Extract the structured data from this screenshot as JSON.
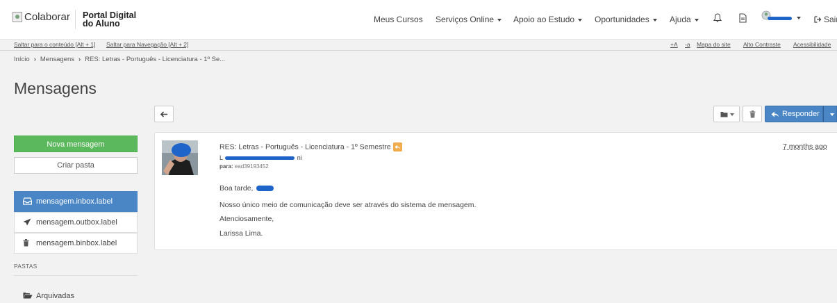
{
  "brand": {
    "logo_alt": "Colaborar",
    "line1": "Portal Digital",
    "line2": "do Aluno"
  },
  "nav": {
    "items": [
      {
        "label": "Meus Cursos",
        "dropdown": false
      },
      {
        "label": "Serviços Online",
        "dropdown": true
      },
      {
        "label": "Apoio ao Estudo",
        "dropdown": true
      },
      {
        "label": "Oportunidades",
        "dropdown": true
      },
      {
        "label": "Ajuda",
        "dropdown": true
      }
    ],
    "logout_label": "Sair"
  },
  "accessibility": {
    "skip_content": "Saltar para o conteúdo [Alt + 1]",
    "skip_nav": "Saltar para Navegação [Alt + 2]",
    "font_plus": "+A",
    "font_minus": "-a",
    "sitemap": "Mapa do site",
    "contrast": "Alto Contraste",
    "accessibility": "Acessibilidade"
  },
  "breadcrumb": {
    "home": "Início",
    "messages": "Mensagens",
    "current": "RES: Letras - Português - Licenciatura - 1º Se..."
  },
  "page_title": "Mensagens",
  "toolbar": {
    "reply_label": "Responder"
  },
  "sidebar": {
    "new_message": "Nova mensagem",
    "create_folder": "Criar pasta",
    "mailboxes": [
      {
        "label": "mensagem.inbox.label",
        "icon": "inbox-icon",
        "active": true
      },
      {
        "label": "mensagem.outbox.label",
        "icon": "send-icon",
        "active": false
      },
      {
        "label": "mensagem.binbox.label",
        "icon": "trash-icon",
        "active": false
      }
    ],
    "folders_heading": "PASTAS",
    "folders": [
      {
        "label": "Arquivadas",
        "icon": "folder-open-icon"
      }
    ]
  },
  "message": {
    "subject": "RES: Letras - Português - Licenciatura - 1º Semestre",
    "sender_prefix": "L",
    "sender_suffix": "ni",
    "to_label": "para:",
    "to_value": "ead39193452",
    "date": "7 months ago",
    "greeting": "Boa tarde,",
    "body": [
      "Nosso único meio de comunicação deve ser através do sistema de mensagem.",
      "Atenciosamente,",
      "Larissa Lima."
    ]
  },
  "colors": {
    "primary": "#4a86c5",
    "success": "#5cb85c",
    "warning": "#f0ad4e",
    "redaction": "#1f64c8"
  }
}
